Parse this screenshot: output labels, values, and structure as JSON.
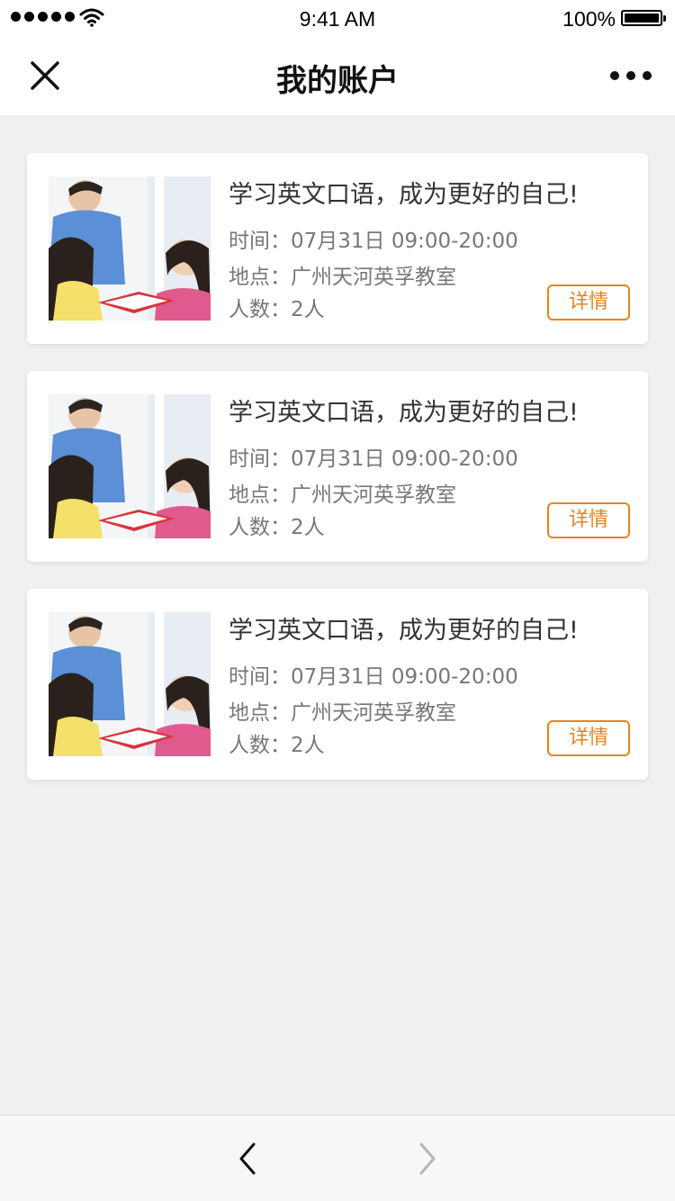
{
  "status_bar": {
    "time": "9:41 AM",
    "battery": "100%",
    "icons": [
      "signal-icon",
      "wifi-icon",
      "battery-icon"
    ]
  },
  "nav": {
    "title": "我的账户",
    "close_icon": "close-icon",
    "more_icon": "more-icon"
  },
  "cards": [
    {
      "title": "学习英文口语，成为更好的自己!",
      "time_label": "时间：",
      "time_value": "07月31日 09:00-20:00",
      "place_label": "地点：",
      "place_value": "广州天河英孚教室",
      "count_label": "人数：",
      "count_value": "2人",
      "detail_label": "详情"
    },
    {
      "title": "学习英文口语，成为更好的自己!",
      "time_label": "时间：",
      "time_value": "07月31日 09:00-20:00",
      "place_label": "地点：",
      "place_value": "广州天河英孚教室",
      "count_label": "人数：",
      "count_value": "2人",
      "detail_label": "详情"
    },
    {
      "title": "学习英文口语，成为更好的自己!",
      "time_label": "时间：",
      "time_value": "07月31日 09:00-20:00",
      "place_label": "地点：",
      "place_value": "广州天河英孚教室",
      "count_label": "人数：",
      "count_value": "2人",
      "detail_label": "详情"
    }
  ],
  "toolbar": {
    "back_icon": "chevron-left-icon",
    "forward_icon": "chevron-right-icon"
  },
  "colors": {
    "accent": "#e8831b",
    "background": "#f0f0f2",
    "card": "#ffffff"
  }
}
